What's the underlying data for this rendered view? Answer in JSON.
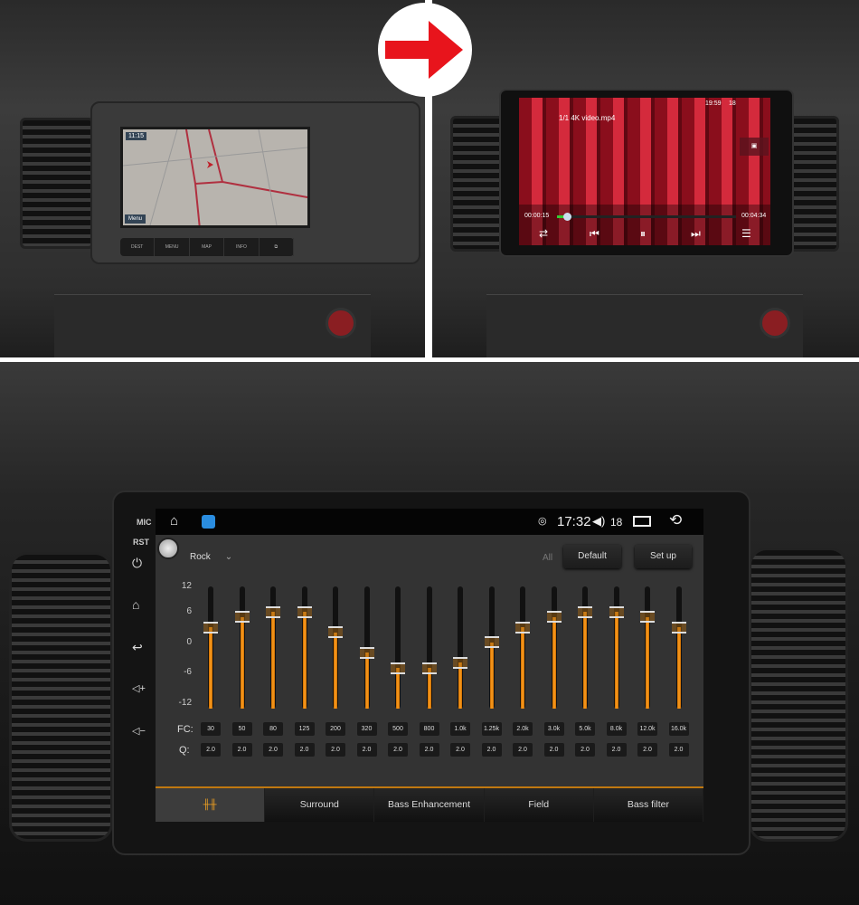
{
  "original_unit": {
    "nav_clock": "11:15",
    "buttons": [
      "DEST",
      "MENU",
      "MAP",
      "INFO"
    ],
    "map_menu": "Menu"
  },
  "video_player": {
    "title": "1/1 4K video.mp4",
    "clock": "19:59",
    "volume": "18",
    "elapsed": "00:00:15",
    "duration": "00:04:34",
    "progress_fraction": 0.055
  },
  "arrow_color": "#e8141c",
  "bezel": {
    "mic": "MIC",
    "rst": "RST",
    "buttons": [
      "power-icon",
      "home-icon",
      "back-icon",
      "volume-up-icon",
      "volume-down-icon"
    ]
  },
  "status_bar": {
    "time": "17:32",
    "volume": "18",
    "icons": [
      "home-icon",
      "eq-app-icon",
      "hotspot-icon",
      "volume-icon",
      "recent-apps-icon",
      "back-icon"
    ]
  },
  "eq": {
    "preset": "Rock",
    "all_label": "All",
    "default_label": "Default",
    "setup_label": "Set up",
    "y_ticks": [
      "12",
      "6",
      "0",
      "-6",
      "-12"
    ],
    "range": [
      -12,
      12
    ],
    "fc_label": "FC:",
    "q_label": "Q:",
    "bands": [
      {
        "fc": "30",
        "q": "2.0",
        "gain": 4
      },
      {
        "fc": "50",
        "q": "2.0",
        "gain": 6
      },
      {
        "fc": "80",
        "q": "2.0",
        "gain": 7
      },
      {
        "fc": "125",
        "q": "2.0",
        "gain": 7
      },
      {
        "fc": "200",
        "q": "2.0",
        "gain": 3
      },
      {
        "fc": "320",
        "q": "2.0",
        "gain": -1
      },
      {
        "fc": "500",
        "q": "2.0",
        "gain": -4
      },
      {
        "fc": "800",
        "q": "2.0",
        "gain": -4
      },
      {
        "fc": "1.0k",
        "q": "2.0",
        "gain": -3
      },
      {
        "fc": "1.25k",
        "q": "2.0",
        "gain": 1
      },
      {
        "fc": "2.0k",
        "q": "2.0",
        "gain": 4
      },
      {
        "fc": "3.0k",
        "q": "2.0",
        "gain": 6
      },
      {
        "fc": "5.0k",
        "q": "2.0",
        "gain": 7
      },
      {
        "fc": "8.0k",
        "q": "2.0",
        "gain": 7
      },
      {
        "fc": "12.0k",
        "q": "2.0",
        "gain": 6
      },
      {
        "fc": "16.0k",
        "q": "2.0",
        "gain": 4
      }
    ],
    "accent": "#f39a1a"
  },
  "tabs": [
    {
      "icon": "equalizer-icon",
      "label": ""
    },
    {
      "label": "Surround"
    },
    {
      "label": "Bass Enhancement"
    },
    {
      "label": "Field"
    },
    {
      "label": "Bass filter"
    }
  ]
}
